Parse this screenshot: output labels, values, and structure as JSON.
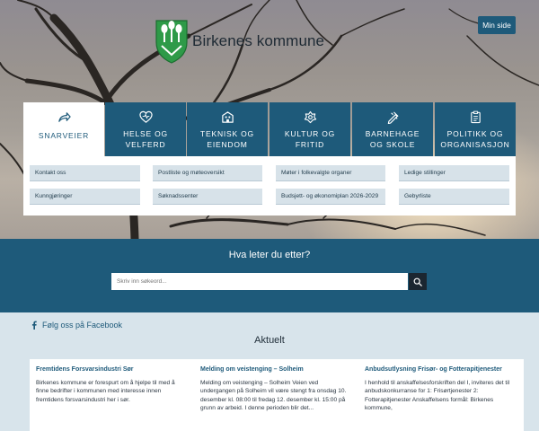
{
  "header": {
    "site_name": "Birkenes kommune",
    "min_side": "Min side"
  },
  "nav": {
    "tabs": [
      {
        "label": "SNARVEIER",
        "icon": "share-arrow-icon",
        "active": true
      },
      {
        "label": "HELSE OG VELFERD",
        "icon": "heart-icon",
        "active": false
      },
      {
        "label": "TEKNISK OG EIENDOM",
        "icon": "building-icon",
        "active": false
      },
      {
        "label": "KULTUR OG FRITID",
        "icon": "flower-icon",
        "active": false
      },
      {
        "label": "BARNEHAGE OG SKOLE",
        "icon": "pencil-ruler-icon",
        "active": false
      },
      {
        "label": "POLITIKK OG ORGANISASJON",
        "icon": "clipboard-icon",
        "active": false
      }
    ],
    "quick_links": [
      "Kontakt oss",
      "Postliste og møteoversikt",
      "Møter i folkevalgte organer",
      "Ledige stillinger",
      "Kunngjøringer",
      "Søknadssenter",
      "Budsjett- og økonomiplan 2026-2029",
      "Gebyrliste"
    ]
  },
  "search": {
    "title": "Hva leter du etter?",
    "placeholder": "Skriv inn søkeord..."
  },
  "social": {
    "facebook": "Følg oss på Facebook"
  },
  "news": {
    "heading": "Aktuelt",
    "items": [
      {
        "title": "Fremtidens Forsvarsindustri Sør",
        "body": "Birkenes kommune er forespurt om å hjelpe til med å finne bedrifter i kommunen med interesse innen fremtidens forsvarsindustri her i sør."
      },
      {
        "title": "Melding om veistenging – Solheim",
        "body": "Melding om veistenging – Solheim Veien ved undergangen på Solheim vil være stengt fra onsdag 10. desember kl. 08:00 til fredag 12. desember kl. 15:00 på grunn av arbeid. I denne perioden blir det..."
      },
      {
        "title": "Anbudsutlysning Frisør- og Fotterapitjenester",
        "body": "I henhold til anskaffelsesforskriften del I, inviteres det til anbudskonkurranse for 1: Frisørtjenester 2: Fotterapitjenester Anskaffelsens formål: Birkenes kommune,"
      }
    ]
  },
  "colors": {
    "primary": "#1e5a7a",
    "link_bg": "#d7e2e9",
    "lower_bg": "#d8e4eb",
    "crest_green": "#2e9a48"
  }
}
